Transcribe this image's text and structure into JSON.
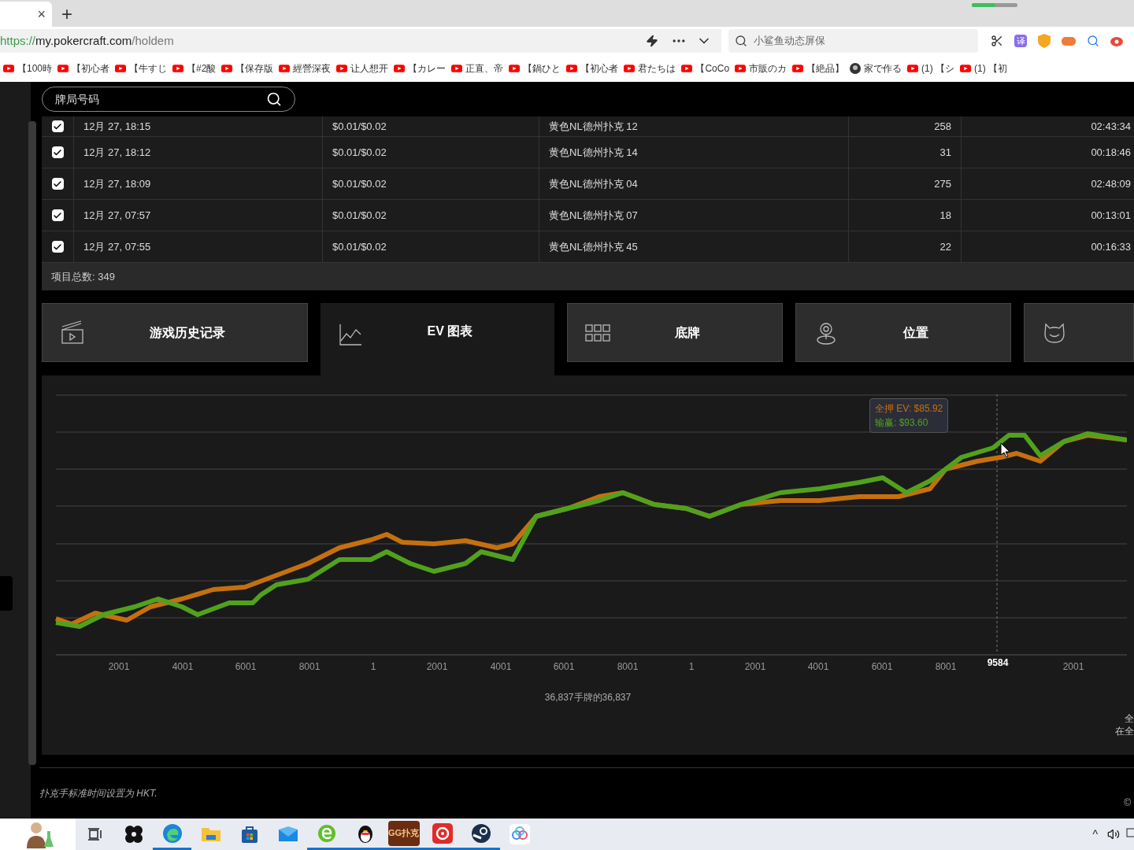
{
  "browser": {
    "tab_close": "×",
    "new_tab": "+",
    "url": {
      "scheme": "https://",
      "host": "my.pokercraft.com",
      "path": "/holdem"
    },
    "search_placeholder": "小鲨鱼动态屏保",
    "ext_translate": "译",
    "bookmarks": [
      {
        "kind": "youtube",
        "label": "【100時"
      },
      {
        "kind": "youtube",
        "label": "【初心者"
      },
      {
        "kind": "youtube",
        "label": "【牛すじ"
      },
      {
        "kind": "youtube",
        "label": "【#2酸"
      },
      {
        "kind": "youtube",
        "label": "【保存版"
      },
      {
        "kind": "youtube",
        "label": "經營深夜"
      },
      {
        "kind": "youtube",
        "label": "让人想开"
      },
      {
        "kind": "youtube",
        "label": "【カレー"
      },
      {
        "kind": "youtube",
        "label": "正直、帝"
      },
      {
        "kind": "youtube",
        "label": "【鍋ひと"
      },
      {
        "kind": "youtube",
        "label": "【初心者"
      },
      {
        "kind": "youtube",
        "label": "君たちは"
      },
      {
        "kind": "youtube",
        "label": "【CoCo"
      },
      {
        "kind": "youtube",
        "label": "市販のカ"
      },
      {
        "kind": "youtube",
        "label": "【絶品】"
      },
      {
        "kind": "channel",
        "label": "家で作る"
      },
      {
        "kind": "youtube",
        "label": "(1) 【シ"
      },
      {
        "kind": "youtube",
        "label": "(1) 【初"
      }
    ]
  },
  "search": {
    "placeholder": "牌局号码"
  },
  "table": {
    "rows": [
      {
        "checked": true,
        "date": "12月 27, 18:15",
        "stakes": "$0.01/$0.02",
        "table": "黄色NL德州扑克 12",
        "hands": "258",
        "duration": "02:43:34"
      },
      {
        "checked": true,
        "date": "12月 27, 18:12",
        "stakes": "$0.01/$0.02",
        "table": "黄色NL德州扑克 14",
        "hands": "31",
        "duration": "00:18:46"
      },
      {
        "checked": true,
        "date": "12月 27, 18:09",
        "stakes": "$0.01/$0.02",
        "table": "黄色NL德州扑克 04",
        "hands": "275",
        "duration": "02:48:09"
      },
      {
        "checked": true,
        "date": "12月 27, 07:57",
        "stakes": "$0.01/$0.02",
        "table": "黄色NL德州扑克 07",
        "hands": "18",
        "duration": "00:13:01"
      },
      {
        "checked": true,
        "date": "12月 27, 07:55",
        "stakes": "$0.01/$0.02",
        "table": "黄色NL德州扑克 45",
        "hands": "22",
        "duration": "00:16:33"
      }
    ],
    "total": "项目总数: 349"
  },
  "tabs": [
    {
      "kind": "history",
      "label": "游戏历史记录",
      "selected": false
    },
    {
      "kind": "ev",
      "label": "EV 图表",
      "selected": true
    },
    {
      "kind": "cards",
      "label": "底牌",
      "selected": false
    },
    {
      "kind": "position",
      "label": "位置",
      "selected": false
    },
    {
      "kind": "opponent",
      "selected": false
    }
  ],
  "chart": {
    "x_tick_labels": [
      "2001",
      "4001",
      "6001",
      "8001",
      "1",
      "2001",
      "4001",
      "6001",
      "8001",
      "1",
      "2001",
      "4001",
      "6001",
      "8001",
      "2001"
    ],
    "cursor_label": "9584",
    "series": [
      {
        "color": "#c5700f"
      },
      {
        "color": "#52a11d"
      }
    ],
    "tooltip": [
      {
        "text": "全押 EV: $85.92",
        "color": "#c5700f"
      },
      {
        "text": "输赢: $93.60",
        "color": "#52a11d"
      }
    ],
    "caption": "36,837手牌的36,837",
    "side_notes": [
      "全",
      "在全"
    ]
  },
  "footer": {
    "note": "扑克手标准时间设置为 HKT.",
    "copyright": "©"
  },
  "taskbar": {
    "apps": [
      {
        "kind": "figure",
        "active": false
      },
      {
        "kind": "taskview",
        "active": false
      },
      {
        "kind": "pinwheel",
        "active": false
      },
      {
        "kind": "edge",
        "active": true
      },
      {
        "kind": "folder",
        "active": false
      },
      {
        "kind": "store",
        "active": false
      },
      {
        "kind": "mail",
        "active": false
      },
      {
        "kind": "ie",
        "active": true
      },
      {
        "kind": "penguin",
        "active": true
      },
      {
        "kind": "gg",
        "label": "GG扑克",
        "active": true
      },
      {
        "kind": "music",
        "active": true
      },
      {
        "kind": "steam",
        "active": true
      },
      {
        "kind": "cloud",
        "active": false
      }
    ],
    "tray_chevron": "^"
  }
}
